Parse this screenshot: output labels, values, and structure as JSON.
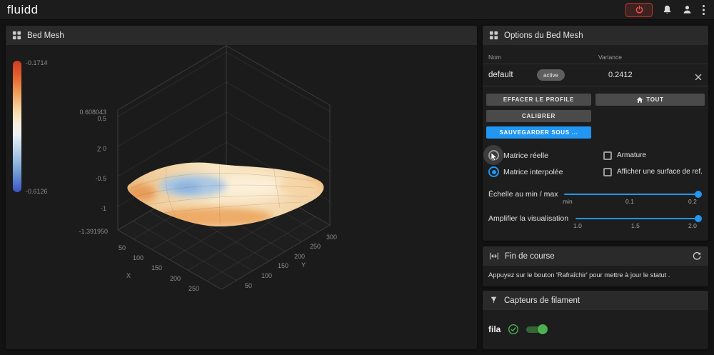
{
  "colors": {
    "accent": "#2196f3",
    "success": "#4caf50",
    "danger": "#f44336"
  },
  "topbar": {
    "logo": "fluidd"
  },
  "bed_mesh": {
    "title": "Bed Mesh",
    "colorbar": {
      "top": "-0.1714",
      "bottom": "-0.6126"
    },
    "axes": {
      "z_ticks": [
        "0.608043",
        "0.5",
        "0",
        "-0.5",
        "-1",
        "-1.391950"
      ],
      "x_ticks": [
        "50",
        "100",
        "150",
        "200",
        "250"
      ],
      "y_ticks": [
        "50",
        "100",
        "150",
        "200",
        "250",
        "300"
      ],
      "x_label": "X",
      "y_label": "Y",
      "z_label": "Z"
    }
  },
  "options": {
    "title": "Options du Bed Mesh",
    "table": {
      "col_name": "Nom",
      "col_variance": "Variance",
      "row": {
        "name": "default",
        "badge": "active",
        "variance": "0.2412"
      }
    },
    "buttons": {
      "clear": "EFFACER LE PROFILE",
      "all": "TOUT",
      "calibrate": "CALIBRER",
      "save_as": "SAUVEGARDER SOUS ..."
    },
    "radios": {
      "real": "Matrice réelle",
      "interpolated": "Matrice interpolée"
    },
    "checkboxes": {
      "wireframe": "Armature",
      "ref_surface": "Afficher une surface de ref."
    },
    "scale_slider": {
      "label": "Échelle au min / max",
      "ticks": [
        "min",
        "0.1",
        "0.2"
      ]
    },
    "boost_slider": {
      "label": "Amplifier la visualisation",
      "ticks": [
        "1.0",
        "1.5",
        "2.0"
      ]
    }
  },
  "endstops": {
    "title": "Fin de course",
    "message": "Appuyez sur le bouton 'Rafraîchir' pour mettre à jour le statut ."
  },
  "filament": {
    "title": "Capteurs de filament",
    "sensor_name": "fila"
  }
}
